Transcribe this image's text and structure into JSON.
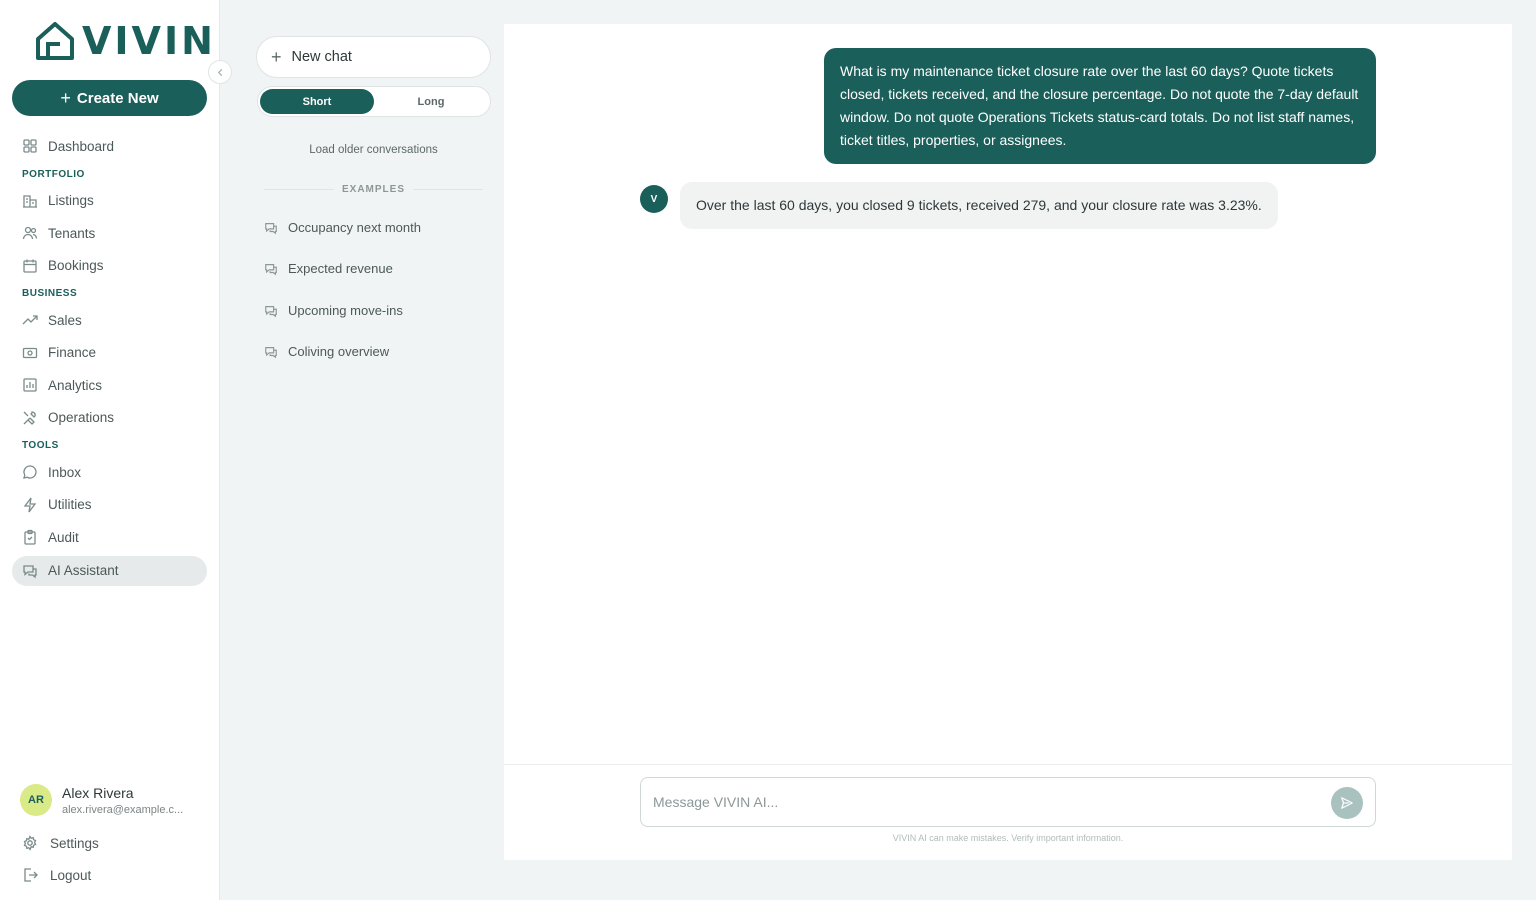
{
  "app": {
    "logo_text": "VIVIN",
    "collapse_icon": "chevron-left-icon"
  },
  "sidebar": {
    "create_label": "Create New",
    "sections": {
      "portfolio": "PORTFOLIO",
      "business": "BUSINESS",
      "tools": "TOOLS"
    },
    "items": {
      "dashboard": "Dashboard",
      "listings": "Listings",
      "tenants": "Tenants",
      "bookings": "Bookings",
      "sales": "Sales",
      "finance": "Finance",
      "analytics": "Analytics",
      "operations": "Operations",
      "inbox": "Inbox",
      "utilities": "Utilities",
      "audit": "Audit",
      "ai_assistant": "AI Assistant"
    },
    "active_item": "AI Assistant",
    "user": {
      "initials": "AR",
      "name": "Alex Rivera",
      "email": "alex.rivera@example.c..."
    },
    "settings_label": "Settings",
    "logout_label": "Logout"
  },
  "chatlist": {
    "new_chat_label": "New chat",
    "toggle": {
      "short": "Short",
      "long": "Long",
      "selected": "Short"
    },
    "load_older": "Load older conversations",
    "examples_header": "EXAMPLES",
    "examples": [
      "Occupancy next month",
      "Expected revenue",
      "Upcoming move-ins",
      "Coliving overview"
    ]
  },
  "chat": {
    "user_message": "What is my maintenance ticket closure rate over the last 60 days? Quote tickets closed, tickets received, and the closure percentage. Do not quote the 7-day default window. Do not quote Operations Tickets status-card totals. Do not list staff names, ticket titles, properties, or assignees.",
    "bot_avatar": "V",
    "bot_message": "Over the last 60 days, you closed 9 tickets, received 279, and your closure rate was 3.23%.",
    "composer": {
      "placeholder": "Message VIVIN AI...",
      "value": ""
    },
    "disclaimer": "VIVIN AI can make mistakes. Verify important information."
  },
  "colors": {
    "brand": "#1b5f5a",
    "avatar_bg": "#d9ea86",
    "background": "#f1f4f4"
  }
}
